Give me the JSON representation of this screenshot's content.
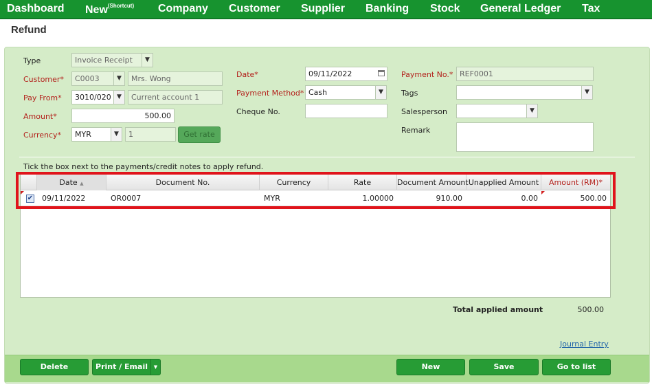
{
  "nav": {
    "dashboard": "Dashboard",
    "new": "New",
    "new_sup": "(Shortcut)",
    "company": "Company",
    "customer": "Customer",
    "supplier": "Supplier",
    "banking": "Banking",
    "stock": "Stock",
    "general_ledger": "General Ledger",
    "tax": "Tax"
  },
  "page_title": "Refund",
  "form": {
    "type_label": "Type",
    "type_value": "Invoice Receipt",
    "customer_label": "Customer*",
    "customer_code": "C0003",
    "customer_name": "Mrs. Wong",
    "payfrom_label": "Pay From*",
    "payfrom_code": "3010/020",
    "payfrom_name": "Current account 1",
    "amount_label": "Amount*",
    "amount_value": "500.00",
    "currency_label": "Currency*",
    "currency_value": "MYR",
    "rate_value": "1",
    "getrate_label": "Get rate",
    "date_label": "Date*",
    "date_value": "09/11/2022",
    "method_label": "Payment Method*",
    "method_value": "Cash",
    "cheque_label": "Cheque No.",
    "cheque_value": "",
    "paymentno_label": "Payment No.*",
    "paymentno_value": "REF0001",
    "tags_label": "Tags",
    "tags_value": "",
    "salesperson_label": "Salesperson",
    "salesperson_value": "",
    "remark_label": "Remark",
    "remark_value": ""
  },
  "hint": "Tick the box next to the payments/credit notes to apply refund.",
  "grid": {
    "headers": {
      "date": "Date",
      "docno": "Document No.",
      "currency": "Currency",
      "rate": "Rate",
      "docamount": "Document Amount",
      "unapplied": "Unapplied Amount",
      "amount": "Amount (RM)*"
    },
    "rows": [
      {
        "checked": true,
        "date": "09/11/2022",
        "docno": "OR0007",
        "currency": "MYR",
        "rate": "1.00000",
        "docamount": "910.00",
        "unapplied": "0.00",
        "amount": "500.00"
      }
    ]
  },
  "total_label": "Total applied amount",
  "total_value": "500.00",
  "journal_link": "Journal Entry",
  "buttons": {
    "delete": "Delete",
    "print_email": "Print / Email",
    "new": "New",
    "save": "Save",
    "go_to_list": "Go to list"
  },
  "colors": {
    "nav_bg": "#17932f",
    "panel_bg": "#d5ecc8",
    "button_green": "#279c35",
    "required_red": "#b3201b",
    "highlight_red": "#e0141b"
  }
}
